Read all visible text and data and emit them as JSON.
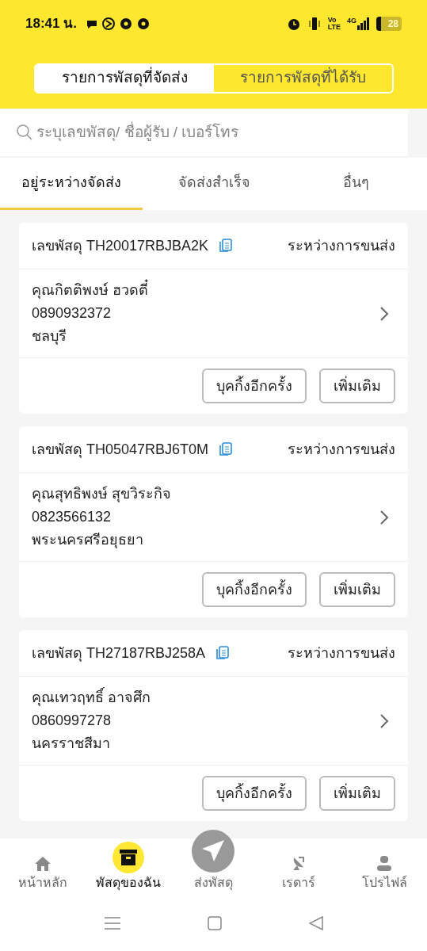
{
  "status_bar": {
    "time": "18:41 น.",
    "volte_top": "Vo",
    "volte_bottom": "LTE",
    "network": "4G",
    "battery": "28"
  },
  "segments": [
    {
      "label": "รายการพัสดุที่จัดส่ง",
      "selected": true
    },
    {
      "label": "รายการพัสดุที่ได้รับ",
      "selected": false
    }
  ],
  "search": {
    "placeholder": "ระบุเลขพัสดุ/ ชื่อผู้รับ / เบอร์โทร"
  },
  "tabs": [
    {
      "label": "อยู่ระหว่างจัดส่ง",
      "selected": true
    },
    {
      "label": "จัดส่งสำเร็จ",
      "selected": false
    },
    {
      "label": "อื่นๆ",
      "selected": false
    }
  ],
  "parcels": [
    {
      "tracking": "เลขพัสดุ TH20017RBJBA2K",
      "status": "ระหว่างการขนส่ง",
      "name": "คุณกิตติพงษ์ ฮวดตี๋",
      "phone": "0890932372",
      "province": "ชลบุรี",
      "buttons": [
        "บุคกิ้งอีกครั้ง",
        "เพิ่มเติม"
      ]
    },
    {
      "tracking": "เลขพัสดุ TH05047RBJ6T0M",
      "status": "ระหว่างการขนส่ง",
      "name": "คุณสุทธิพงษ์ สุขวิระกิจ",
      "phone": "0823566132",
      "province": "พระนครศรีอยุธยา",
      "buttons": [
        "บุคกิ้งอีกครั้ง",
        "เพิ่มเติม"
      ]
    },
    {
      "tracking": "เลขพัสดุ TH27187RBJ258A",
      "status": "ระหว่างการขนส่ง",
      "name": "คุณเทวฤทธิ์ อาจศึก",
      "phone": "0860997278",
      "province": "นครราชสีมา",
      "buttons": [
        "บุคกิ้งอีกครั้ง",
        "เพิ่มเติม"
      ]
    }
  ],
  "bottom_nav": [
    {
      "kind": "home",
      "label": "หน้าหลัก",
      "selected": false
    },
    {
      "kind": "box",
      "label": "พัสดุของฉัน",
      "selected": true
    },
    {
      "kind": "send",
      "label": "ส่งพัสดุ",
      "selected": false
    },
    {
      "kind": "radar",
      "label": "เรดาร์",
      "selected": false
    },
    {
      "kind": "profile",
      "label": "โปรไฟล์",
      "selected": false
    }
  ]
}
